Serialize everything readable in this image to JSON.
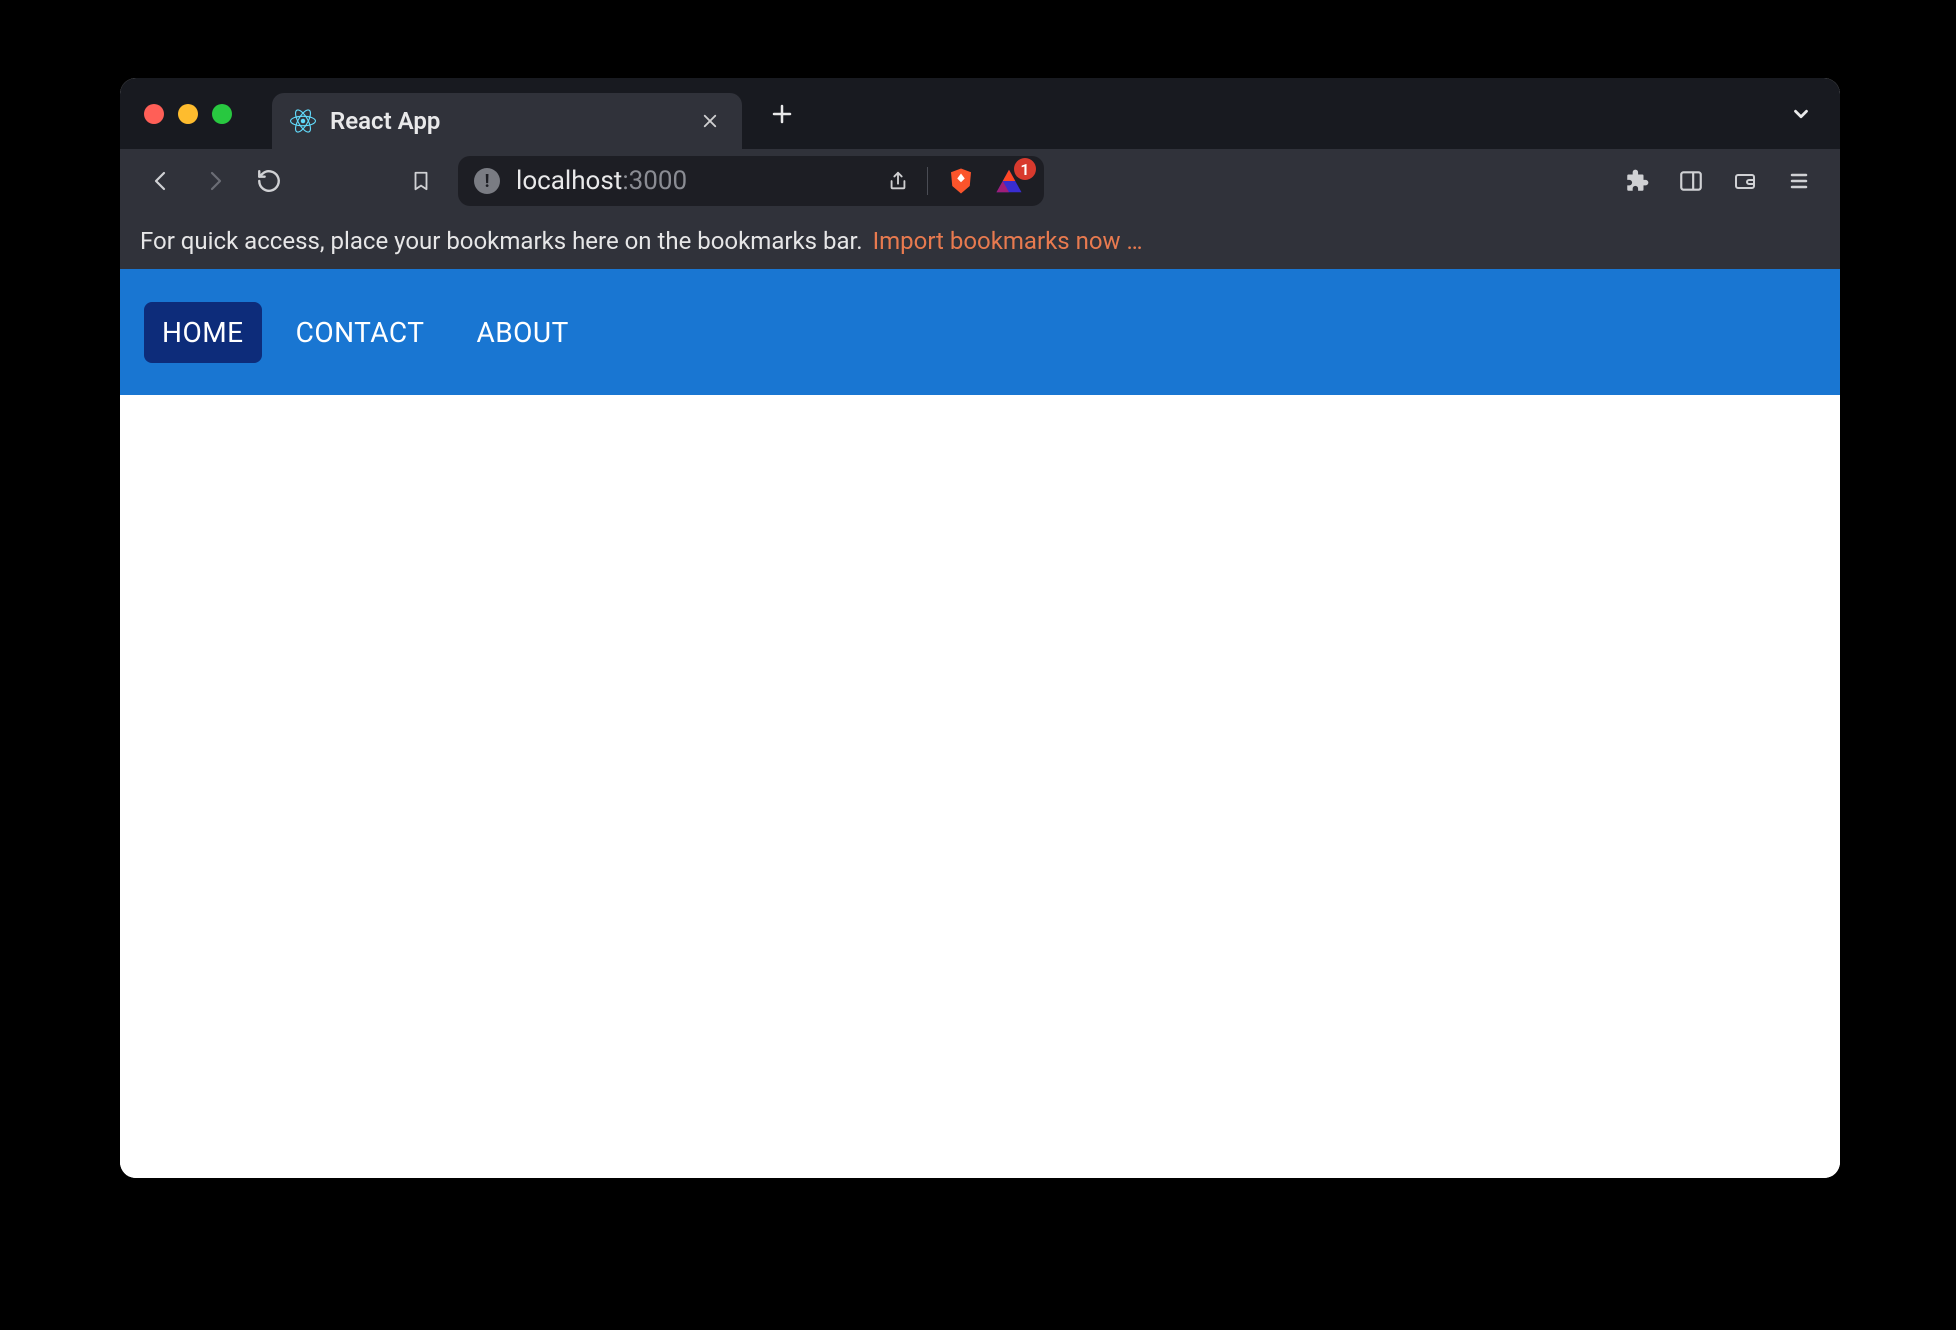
{
  "browser": {
    "tab": {
      "title": "React App"
    },
    "address": {
      "host": "localhost",
      "rest": ":3000"
    },
    "bookmarks_hint": "For quick access, place your bookmarks here on the bookmarks bar.",
    "bookmarks_import": "Import bookmarks now …",
    "extension_badge_count": "1"
  },
  "app": {
    "nav": {
      "items": [
        {
          "label": "HOME"
        },
        {
          "label": "CONTACT"
        },
        {
          "label": "ABOUT"
        }
      ],
      "active_index": 0
    }
  }
}
